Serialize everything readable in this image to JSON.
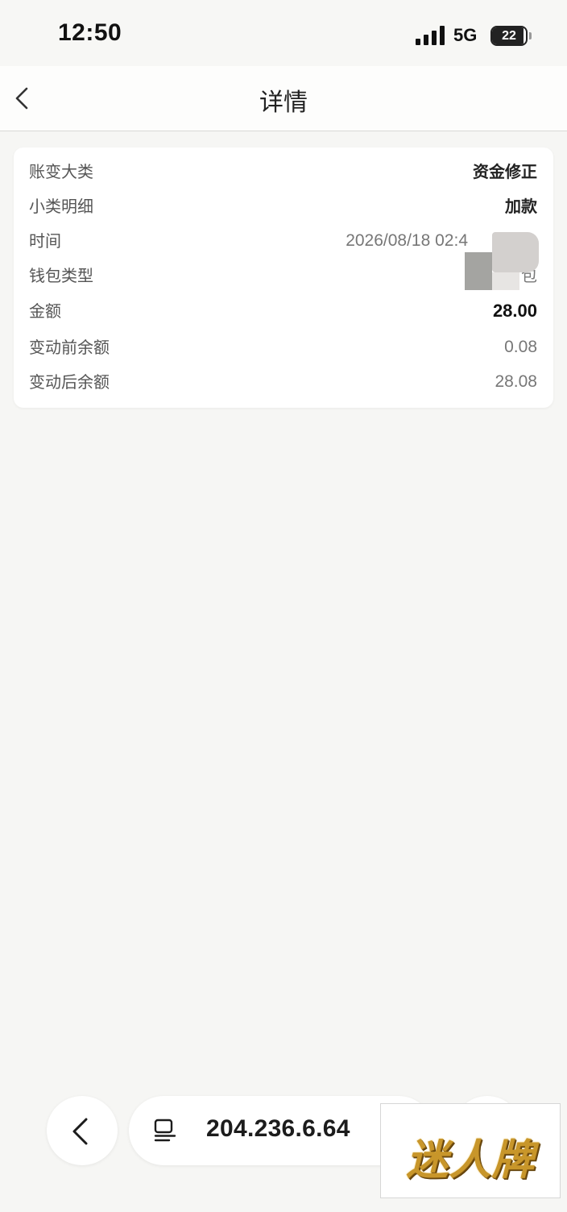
{
  "status_bar": {
    "time": "12:50",
    "network": "5G",
    "battery_level": "22",
    "battery_fraction": 0.22
  },
  "header": {
    "title": "详情",
    "back_icon": "chevron-left-icon"
  },
  "detail": {
    "rows": [
      {
        "label": "账变大类",
        "value": "资金修正"
      },
      {
        "label": "小类明细",
        "value": "加款"
      },
      {
        "label": "时间",
        "value": "2026/08/18 02:4"
      },
      {
        "label": "钱包类型",
        "value": "包"
      },
      {
        "label": "金额",
        "value": "28.00"
      },
      {
        "label": "变动前余额",
        "value": "0.08"
      },
      {
        "label": "变动后余额",
        "value": "28.08"
      }
    ]
  },
  "browser_bar": {
    "back_icon": "chevron-left-icon",
    "page_menu_icon": "page-menu-icon",
    "address": "204.236.6.64"
  },
  "watermark": {
    "text": "迷人牌"
  },
  "colors": {
    "background": "#f6f6f4",
    "card": "#ffffff",
    "label_text": "#555555",
    "value_text": "#777777",
    "strong_text": "#222222"
  }
}
